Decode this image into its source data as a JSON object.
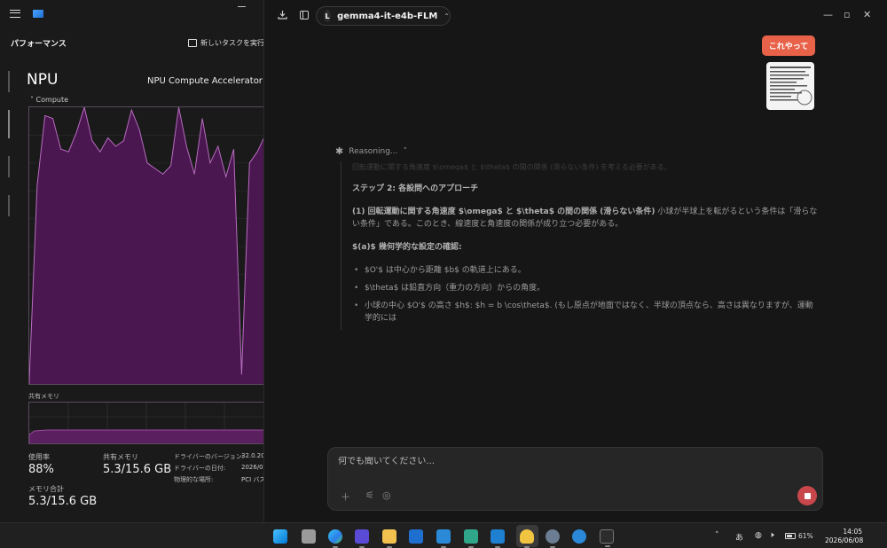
{
  "task_manager": {
    "section_title": "パフォーマンス",
    "new_task_label": "新しいタスクを実行す",
    "device_title": "NPU",
    "device_name": "NPU Compute Accelerator",
    "graph_label": "Compute",
    "shared_memory_label": "共有メモリ",
    "stats": {
      "utilization_label": "使用率",
      "utilization_value": "88%",
      "shared_mem_label": "共有メモリ",
      "shared_mem_value": "5.3/15.6 GB",
      "mem_total_label": "メモリ合計",
      "mem_total_value": "5.3/15.6 GB"
    },
    "properties": [
      {
        "label": "ドライバーのバージョン:",
        "value": "32.0.20"
      },
      {
        "label": "ドライバーの日付:",
        "value": "2026/0"
      },
      {
        "label": "物理的な場所:",
        "value": "PCI バス"
      }
    ],
    "compute_usage_pct": [
      2,
      72,
      97,
      96,
      85,
      84,
      91,
      100,
      88,
      84,
      89,
      86,
      88,
      99,
      92,
      80,
      78,
      76,
      79,
      100,
      86,
      76,
      96,
      80,
      86,
      75,
      85,
      4,
      80,
      84,
      90
    ]
  },
  "chat": {
    "model_badge": "L",
    "model_name": "gemma4-it-e4b-FLM",
    "user_message": "これやって",
    "reasoning_label": "Reasoning...",
    "reasoning": {
      "faded_line": "回転運動に関する角速度 $\\omega$ と $\\theta$ の間の関係 (滑らない条件) を考える必要がある。",
      "step_title": "ステップ 2: 各設問へのアプローチ",
      "para1_bold": "(1) 回転運動に関する角速度 $\\omega$ と $\\theta$ の間の関係 (滑らない条件)",
      "para1_text": " 小球が半球上を転がるという条件は「滑らない条件」である。このとき、線速度と角速度の関係が成り立つ必要がある。",
      "para2_bold": "$(a)$ 幾何学的な設定の確認:",
      "bullets": [
        "$O'$ は中心から距離 $b$ の軌道上にある。",
        "$\\theta$ は鉛直方向（重力の方向）からの角度。",
        "小球の中心 $O'$ の高さ $h$: $h = b \\cos\\theta$. (もし原点が地面ではなく、半球の頂点なら、高さは異なりますが、運動学的には"
      ]
    },
    "composer_placeholder": "何でも聞いてください..."
  },
  "taskbar": {
    "ime": "あ",
    "battery": "61%",
    "time": "14:05",
    "date": "2026/06/08"
  }
}
